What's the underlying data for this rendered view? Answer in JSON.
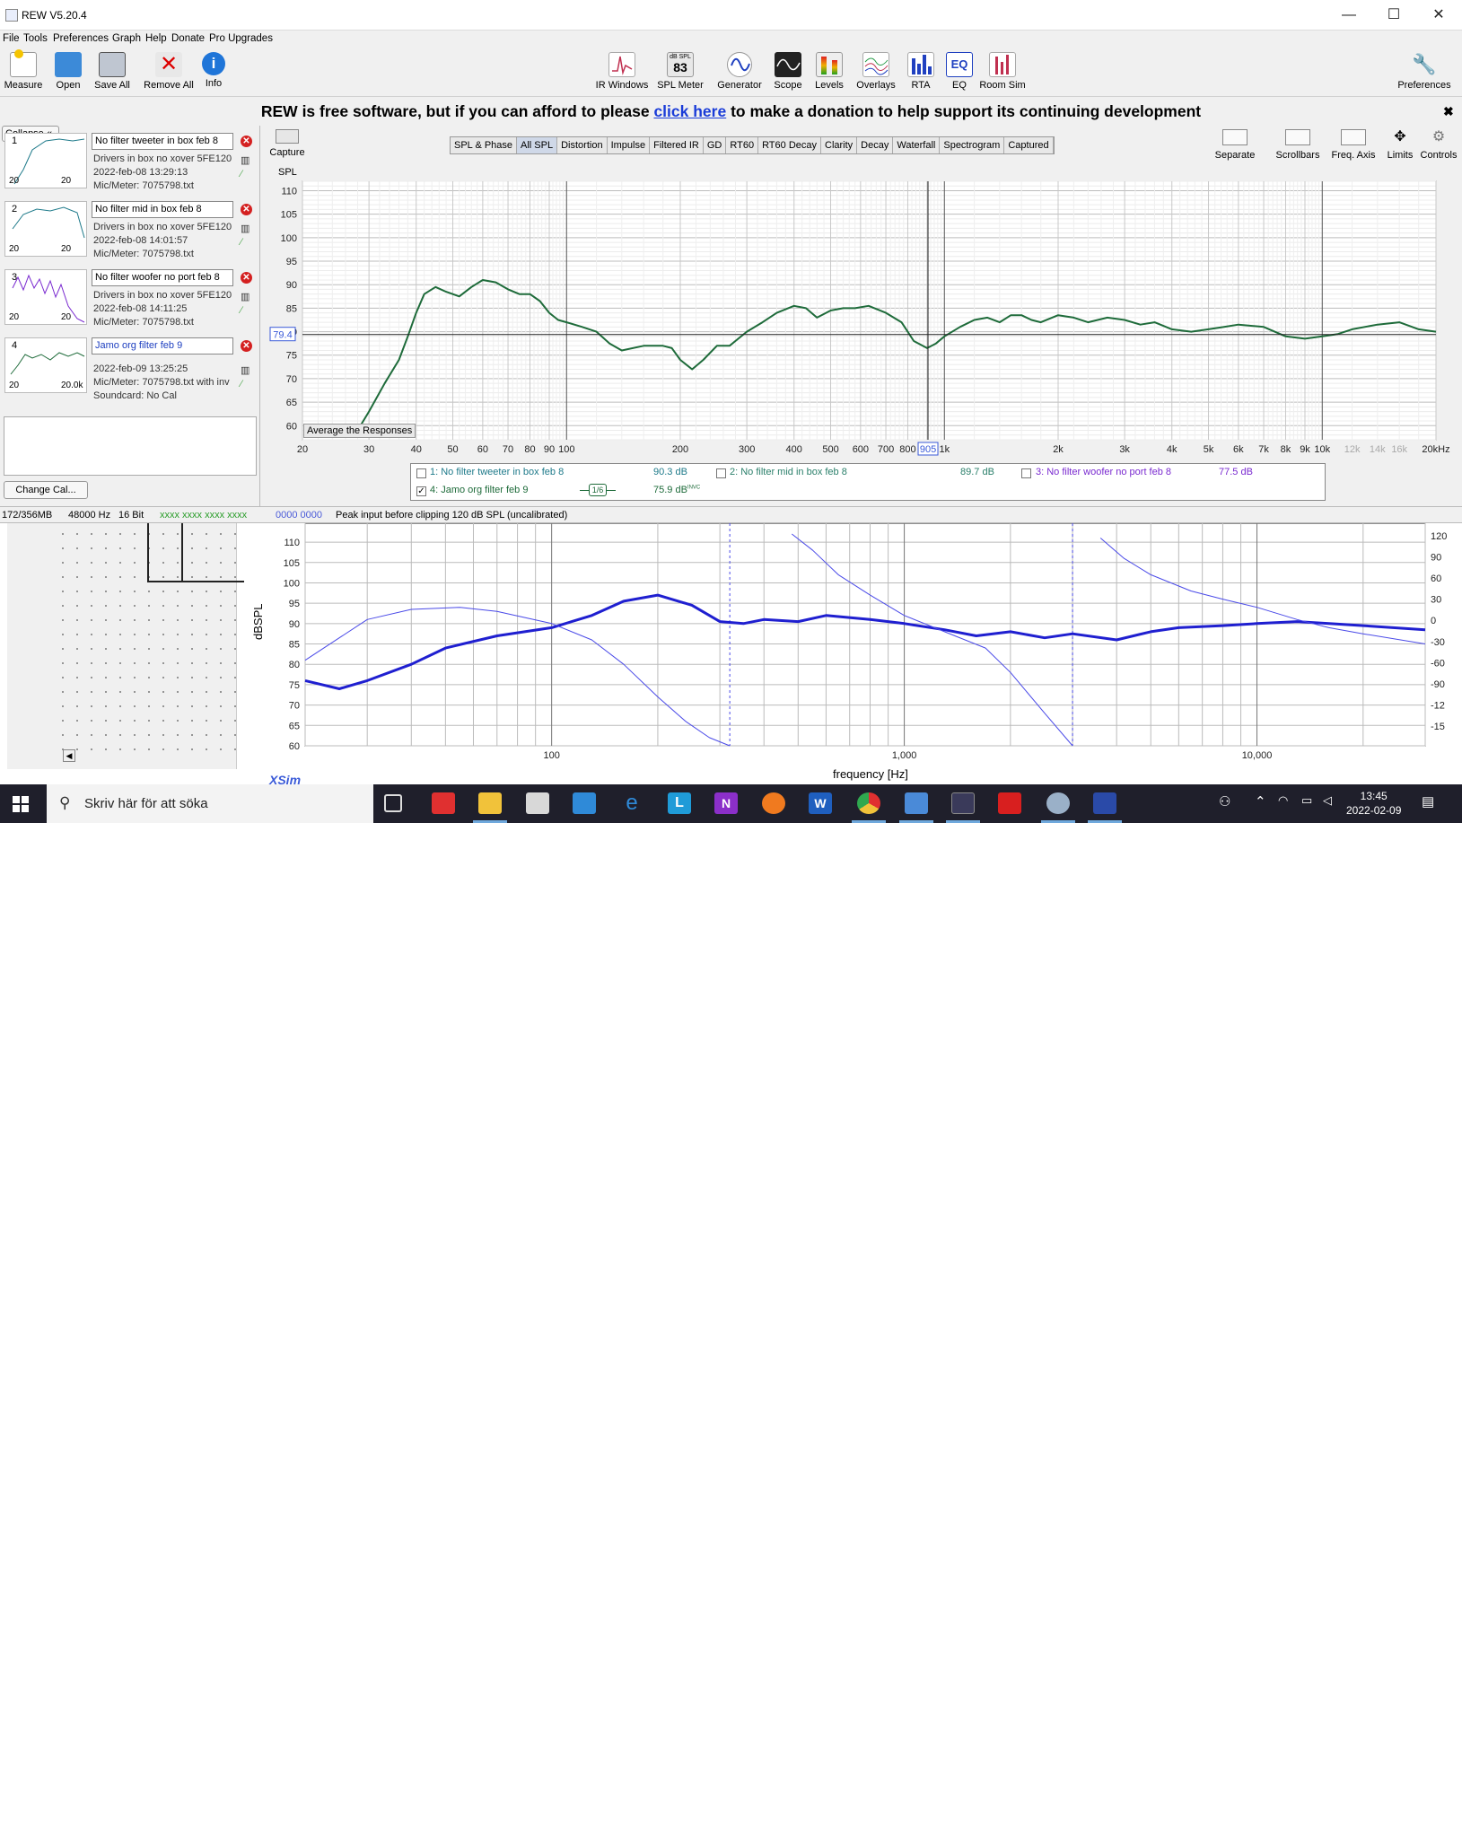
{
  "window": {
    "title": "REW V5.20.4",
    "min": "—",
    "max": "☐",
    "close": "✕"
  },
  "menu": [
    "File",
    "Tools",
    "Preferences",
    "Graph",
    "Help",
    "Donate",
    "Pro Upgrades"
  ],
  "toolbar_left": [
    "Measure",
    "Open",
    "Save All",
    "Remove All",
    "Info"
  ],
  "toolbar_center": [
    "IR Windows",
    "SPL Meter",
    "Generator",
    "Scope",
    "Levels",
    "Overlays",
    "RTA",
    "EQ",
    "Room Sim"
  ],
  "spl_meter_badge": {
    "top": "dB SPL",
    "value": "83"
  },
  "eq_badge": "EQ",
  "toolbar_right": "Preferences",
  "donation": {
    "pre": "REW is free software, but if you can afford to please ",
    "link": "click here",
    "post": " to make a donation to help support its continuing development",
    "close": "✖"
  },
  "left_panel": {
    "collapse": "Collapse",
    "measurements": [
      {
        "num": "1",
        "name": "No filter tweeter in box feb 8",
        "info": [
          "Drivers in box no xover 5FE120",
          "2022-feb-08 13:29:13",
          "Mic/Meter: 7075798.txt"
        ],
        "thumb_low": "20",
        "thumb_high": "20"
      },
      {
        "num": "2",
        "name": "No filter mid in box feb 8",
        "info": [
          "Drivers in box no xover 5FE120",
          "2022-feb-08 14:01:57",
          "Mic/Meter: 7075798.txt"
        ],
        "thumb_low": "20",
        "thumb_high": "20"
      },
      {
        "num": "3",
        "name": "No filter woofer no port feb 8",
        "info": [
          "Drivers in box no xover 5FE120",
          "2022-feb-08 14:11:25",
          "Mic/Meter: 7075798.txt"
        ],
        "thumb_low": "20",
        "thumb_high": "20"
      },
      {
        "num": "4",
        "name": "Jamo org filter feb 9",
        "info": [
          "2022-feb-09 13:25:25",
          "Mic/Meter: 7075798.txt with inv",
          "Soundcard: No Cal"
        ],
        "thumb_low": "20",
        "thumb_high": "20.0k"
      }
    ],
    "change_cal": "Change Cal..."
  },
  "graph": {
    "capture": "Capture",
    "tabs": [
      "SPL & Phase",
      "All SPL",
      "Distortion",
      "Impulse",
      "Filtered IR",
      "GD",
      "RT60",
      "RT60 Decay",
      "Clarity",
      "Decay",
      "Waterfall",
      "Spectrogram",
      "Captured"
    ],
    "active_tab": "All SPL",
    "right_tools": [
      "Separate",
      "Scrollbars",
      "Freq. Axis",
      "Limits",
      "Controls"
    ],
    "y_unit": "SPL",
    "cursor_value": "79.4",
    "cursor_freq": "905",
    "average_button": "Average the Responses",
    "legend": [
      {
        "checked": false,
        "label": "1: No filter tweeter in box feb 8",
        "value": "90.3 dB",
        "color": "#1e7a8a"
      },
      {
        "checked": false,
        "label": "2: No filter mid in box feb 8",
        "value": "89.7 dB",
        "color": "#2a7f6a"
      },
      {
        "checked": false,
        "label": "3: No filter woofer no port feb 8",
        "value": "77.5 dB",
        "color": "#7a2ad0"
      },
      {
        "checked": true,
        "label": "4: Jamo org filter feb 9",
        "value": "75.9 dB",
        "value_sup": "INVC",
        "color": "#1e6b3a",
        "smoothing": "1/6"
      }
    ]
  },
  "chart_data": [
    {
      "type": "line",
      "title": "",
      "xlabel": "",
      "ylabel": "SPL",
      "xscale": "log",
      "xlim": [
        20,
        20000
      ],
      "ylim": [
        57,
        112
      ],
      "y_ticks": [
        60,
        65,
        70,
        75,
        80,
        85,
        90,
        95,
        100,
        105,
        110
      ],
      "x_tick_labels": [
        "20",
        "30",
        "40",
        "50",
        "60",
        "70",
        "80",
        "90",
        "100",
        "200",
        "300",
        "400",
        "500",
        "600",
        "700",
        "800",
        "1k",
        "2k",
        "3k",
        "4k",
        "5k",
        "6k",
        "7k",
        "8k",
        "9k",
        "10k",
        "12k",
        "14k",
        "16k",
        "20kHz"
      ],
      "grid": true,
      "series": [
        {
          "name": "4: Jamo org filter feb 9",
          "color": "#1e6b3a",
          "x": [
            28,
            30,
            33,
            36,
            38,
            40,
            42,
            45,
            48,
            52,
            56,
            60,
            65,
            70,
            75,
            80,
            85,
            90,
            95,
            100,
            110,
            120,
            130,
            140,
            160,
            180,
            190,
            200,
            215,
            230,
            250,
            270,
            300,
            330,
            360,
            400,
            430,
            460,
            500,
            540,
            580,
            630,
            700,
            770,
            830,
            900,
            950,
            1000,
            1100,
            1200,
            1300,
            1400,
            1500,
            1600,
            1700,
            1800,
            2000,
            2200,
            2400,
            2700,
            3000,
            3300,
            3600,
            4000,
            4500,
            5000,
            5500,
            6000,
            7000,
            8000,
            9000,
            10000,
            11000,
            12000,
            14000,
            16000,
            18000,
            20000
          ],
          "y": [
            59,
            63,
            69,
            74,
            79,
            84,
            88,
            89.5,
            88.5,
            87.5,
            89.5,
            91,
            90.5,
            89,
            88,
            88,
            86.5,
            84,
            82.5,
            82,
            81,
            80,
            77.5,
            76,
            77,
            77,
            76.5,
            74,
            72,
            74,
            77,
            77,
            80,
            82,
            84,
            85.5,
            85,
            83,
            84.5,
            85,
            85,
            85.5,
            84,
            82,
            78,
            76.5,
            77.5,
            79,
            81,
            82.5,
            83,
            82,
            83.5,
            83.5,
            82.5,
            82,
            83.5,
            83,
            82,
            83,
            82.5,
            81.5,
            82,
            80.5,
            80,
            80.5,
            81,
            81.5,
            81,
            79,
            78.5,
            79,
            79.5,
            80.5,
            81.5,
            82,
            80.5,
            80
          ]
        }
      ]
    },
    {
      "type": "line",
      "title": "",
      "xlabel": "frequency [Hz]",
      "ylabel": "dBSPL",
      "xscale": "log",
      "xlim": [
        20,
        30000
      ],
      "ylim": [
        60,
        112
      ],
      "x_tick_labels": [
        "100",
        "1,000",
        "10,000"
      ],
      "y_ticks_left": [
        60,
        65,
        70,
        75,
        80,
        85,
        90,
        95,
        100,
        105,
        110
      ],
      "y_ticks_right": [
        "120",
        "90",
        "60",
        "30",
        "0",
        "-30",
        "-60",
        "-90",
        "-12",
        "-15"
      ],
      "grid": true,
      "series": [
        {
          "color": "#1f1fd0",
          "width": "thick",
          "x": [
            20,
            25,
            30,
            40,
            50,
            70,
            100,
            130,
            160,
            200,
            250,
            300,
            350,
            400,
            500,
            600,
            800,
            1000,
            1300,
            1600,
            2000,
            2500,
            3000,
            4000,
            5000,
            6000,
            8000,
            10000,
            13000,
            16000,
            20000,
            30000
          ],
          "y": [
            76,
            74,
            76,
            80,
            84,
            87,
            89,
            92,
            95.5,
            97,
            94.5,
            90.5,
            90,
            91,
            90.5,
            92,
            91,
            90,
            88.5,
            87,
            88,
            86.5,
            87.5,
            86,
            88,
            89,
            89.5,
            90,
            90.5,
            90,
            89.5,
            88.5
          ]
        },
        {
          "color": "#4a4ae8",
          "width": "thin",
          "x": [
            20,
            30,
            40,
            55,
            70,
            100,
            130,
            160,
            200,
            240,
            280,
            320
          ],
          "y": [
            81,
            91,
            93.5,
            94,
            93,
            90,
            86,
            80,
            72,
            66,
            62,
            60
          ]
        },
        {
          "color": "#4a4ae8",
          "width": "thin",
          "x": [
            480,
            550,
            650,
            800,
            1000,
            1300,
            1700,
            2000,
            2500,
            3000
          ],
          "y": [
            112,
            108,
            102,
            97,
            92,
            88,
            84,
            78,
            68,
            60
          ]
        },
        {
          "color": "#4a4ae8",
          "width": "thin",
          "x": [
            3600,
            4200,
            5000,
            6500,
            8000,
            10000,
            13000,
            16000,
            20000,
            30000
          ],
          "y": [
            111,
            106,
            102,
            98,
            96,
            94,
            91,
            89,
            87.5,
            85
          ]
        }
      ]
    }
  ],
  "status": {
    "mem": "172/356MB",
    "rate": "48000 Hz",
    "bits": "16 Bit",
    "levels_green": "xxxx xxxx  xxxx xxxx",
    "levels_blue": "0000 0000",
    "peak": "Peak input before clipping 120 dB SPL (uncalibrated)"
  },
  "xsim": {
    "brand": "XSim",
    "xlabel": "frequency [Hz]",
    "ylabel": "dBSPL"
  },
  "taskbar": {
    "search_placeholder": "Skriv här för att söka",
    "time": "13:45",
    "date": "2022-02-09"
  }
}
